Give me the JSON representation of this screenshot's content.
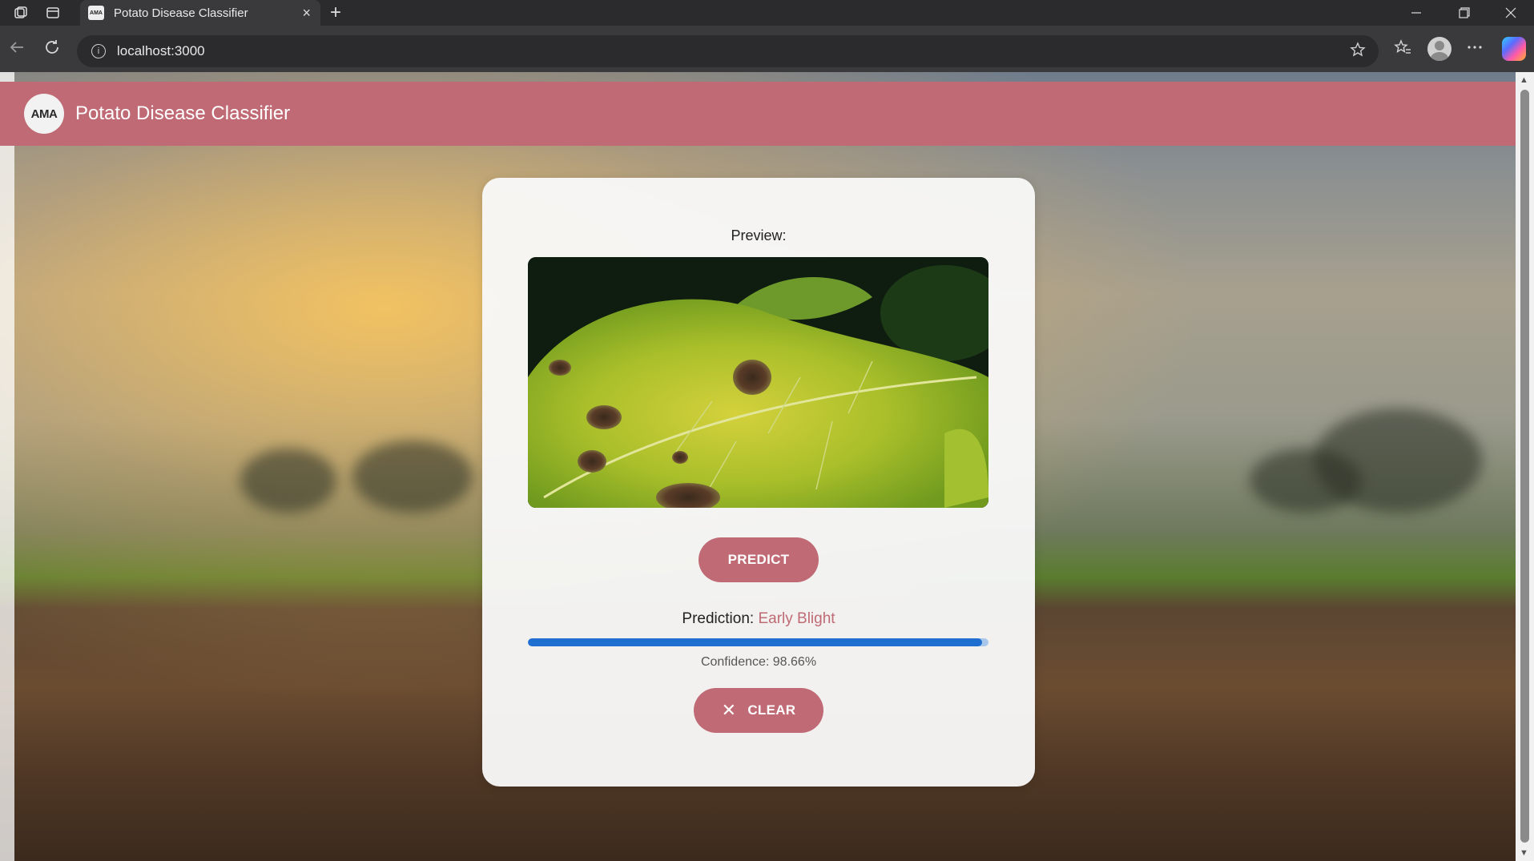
{
  "browser": {
    "tab_title": "Potato Disease Classifier",
    "tab_favicon_text": "AMA",
    "url": "localhost:3000",
    "new_tab_symbol": "+",
    "close_tab_symbol": "×"
  },
  "app": {
    "logo_text": "AMA",
    "title": "Potato Disease Classifier"
  },
  "card": {
    "preview_label": "Preview:",
    "predict_label": "PREDICT",
    "prediction_label": "Prediction: ",
    "prediction_value": "Early Blight",
    "confidence_text": "Confidence: 98.66%",
    "confidence_percent": 98.66,
    "clear_label": "CLEAR"
  },
  "colors": {
    "accent": "#bf6a74",
    "progress": "#1e6fcf"
  }
}
